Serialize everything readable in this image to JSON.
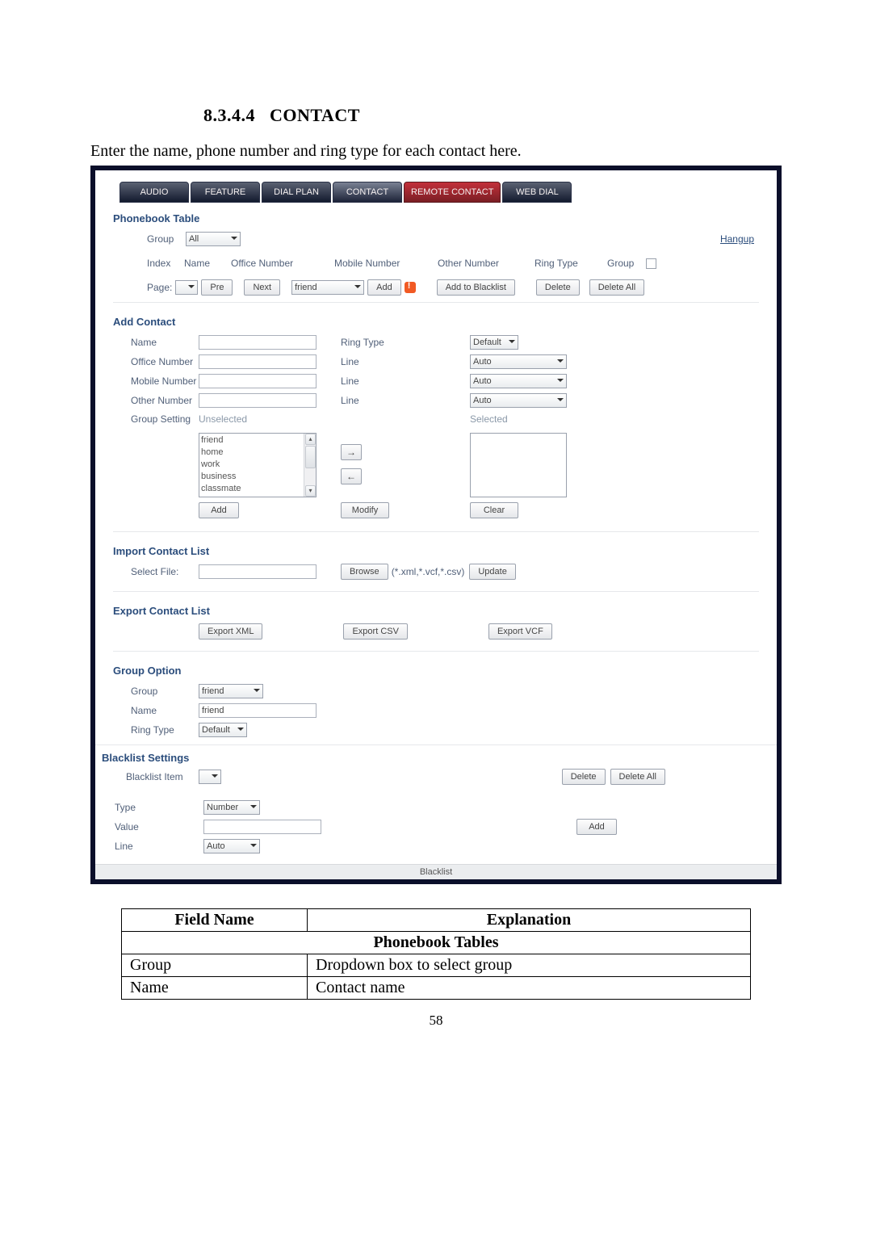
{
  "heading_number": "8.3.4.4",
  "heading_title": "CONTACT",
  "intro": "Enter the name, phone number and ring type for each contact here.",
  "tabs": {
    "audio": "AUDIO",
    "feature": "FEATURE",
    "dialplan": "DIAL PLAN",
    "contact": "CONTACT",
    "remote": "REMOTE CONTACT",
    "webdial": "WEB DIAL"
  },
  "phonebook": {
    "title": "Phonebook Table",
    "group_label": "Group",
    "group_value": "All",
    "hangup": "Hangup",
    "cols": {
      "index": "Index",
      "name": "Name",
      "office": "Office Number",
      "mobile": "Mobile Number",
      "other": "Other Number",
      "ringtype": "Ring Type",
      "group": "Group"
    },
    "page_label": "Page:",
    "pre_btn": "Pre",
    "next_btn": "Next",
    "friend_sel": "friend",
    "add_btn": "Add",
    "add_blacklist_btn": "Add to Blacklist",
    "delete_btn": "Delete",
    "delete_all_btn": "Delete All"
  },
  "add_contact": {
    "title": "Add Contact",
    "name_label": "Name",
    "office_label": "Office Number",
    "mobile_label": "Mobile Number",
    "other_label": "Other Number",
    "group_label": "Group Setting",
    "ringtype_label": "Ring Type",
    "ringtype_value": "Default",
    "line_label": "Line",
    "line_value": "Auto",
    "unselected_label": "Unselected",
    "selected_label": "Selected",
    "groups": [
      "friend",
      "home",
      "work",
      "business",
      "classmate"
    ],
    "add_btn": "Add",
    "modify_btn": "Modify",
    "clear_btn": "Clear"
  },
  "import_list": {
    "title": "Import Contact List",
    "select_file": "Select File:",
    "browse_btn": "Browse",
    "formats": "(*.xml,*.vcf,*.csv)",
    "update_btn": "Update"
  },
  "export_list": {
    "title": "Export Contact List",
    "xml_btn": "Export XML",
    "csv_btn": "Export CSV",
    "vcf_btn": "Export VCF"
  },
  "group_option": {
    "title": "Group Option",
    "group_label": "Group",
    "group_value": "friend",
    "name_label": "Name",
    "name_value": "friend",
    "ring_label": "Ring Type",
    "ring_value": "Default"
  },
  "blacklist": {
    "title": "Blacklist Settings",
    "item_label": "Blacklist Item",
    "delete_btn": "Delete",
    "delete_all_btn": "Delete All",
    "type_label": "Type",
    "type_value": "Number",
    "value_label": "Value",
    "add_btn": "Add",
    "line_label": "Line",
    "line_value": "Auto",
    "footer": "Blacklist"
  },
  "explain_table": {
    "field_name_header": "Field Name",
    "explanation_header": "Explanation",
    "section": "Phonebook Tables",
    "rows": [
      {
        "field": "Group",
        "explanation": "Dropdown box to select group"
      },
      {
        "field": "Name",
        "explanation": "Contact name"
      }
    ]
  },
  "page_number": "58"
}
